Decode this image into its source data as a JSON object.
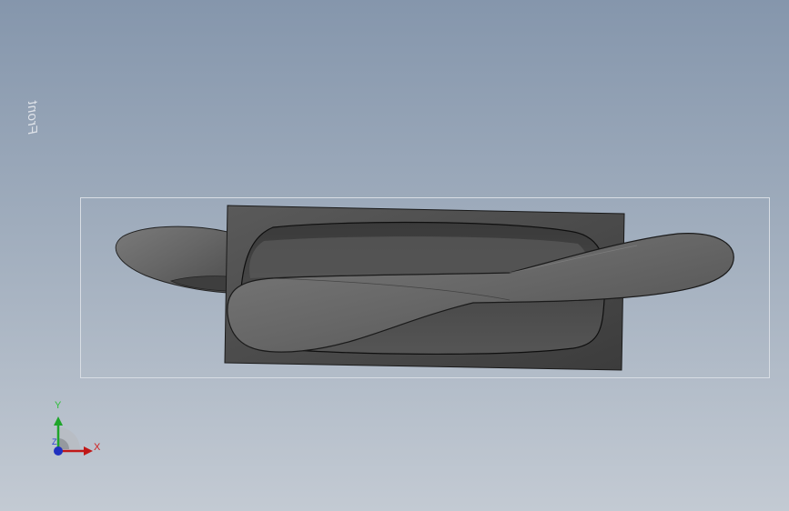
{
  "viewport": {
    "plane_label": "Front",
    "background_top": "#8596ac",
    "background_bottom": "#c3cad3"
  },
  "model": {
    "name": "propeller-blade-plate",
    "plate_color": "#4a4a4a",
    "blade_color": "#6a6a6a",
    "edge_color": "#111111"
  },
  "triad": {
    "x_label": "X",
    "y_label": "Y",
    "z_label": "Z",
    "x_color": "#c01818",
    "y_color": "#1fa52a",
    "z_color": "#2030c0"
  }
}
